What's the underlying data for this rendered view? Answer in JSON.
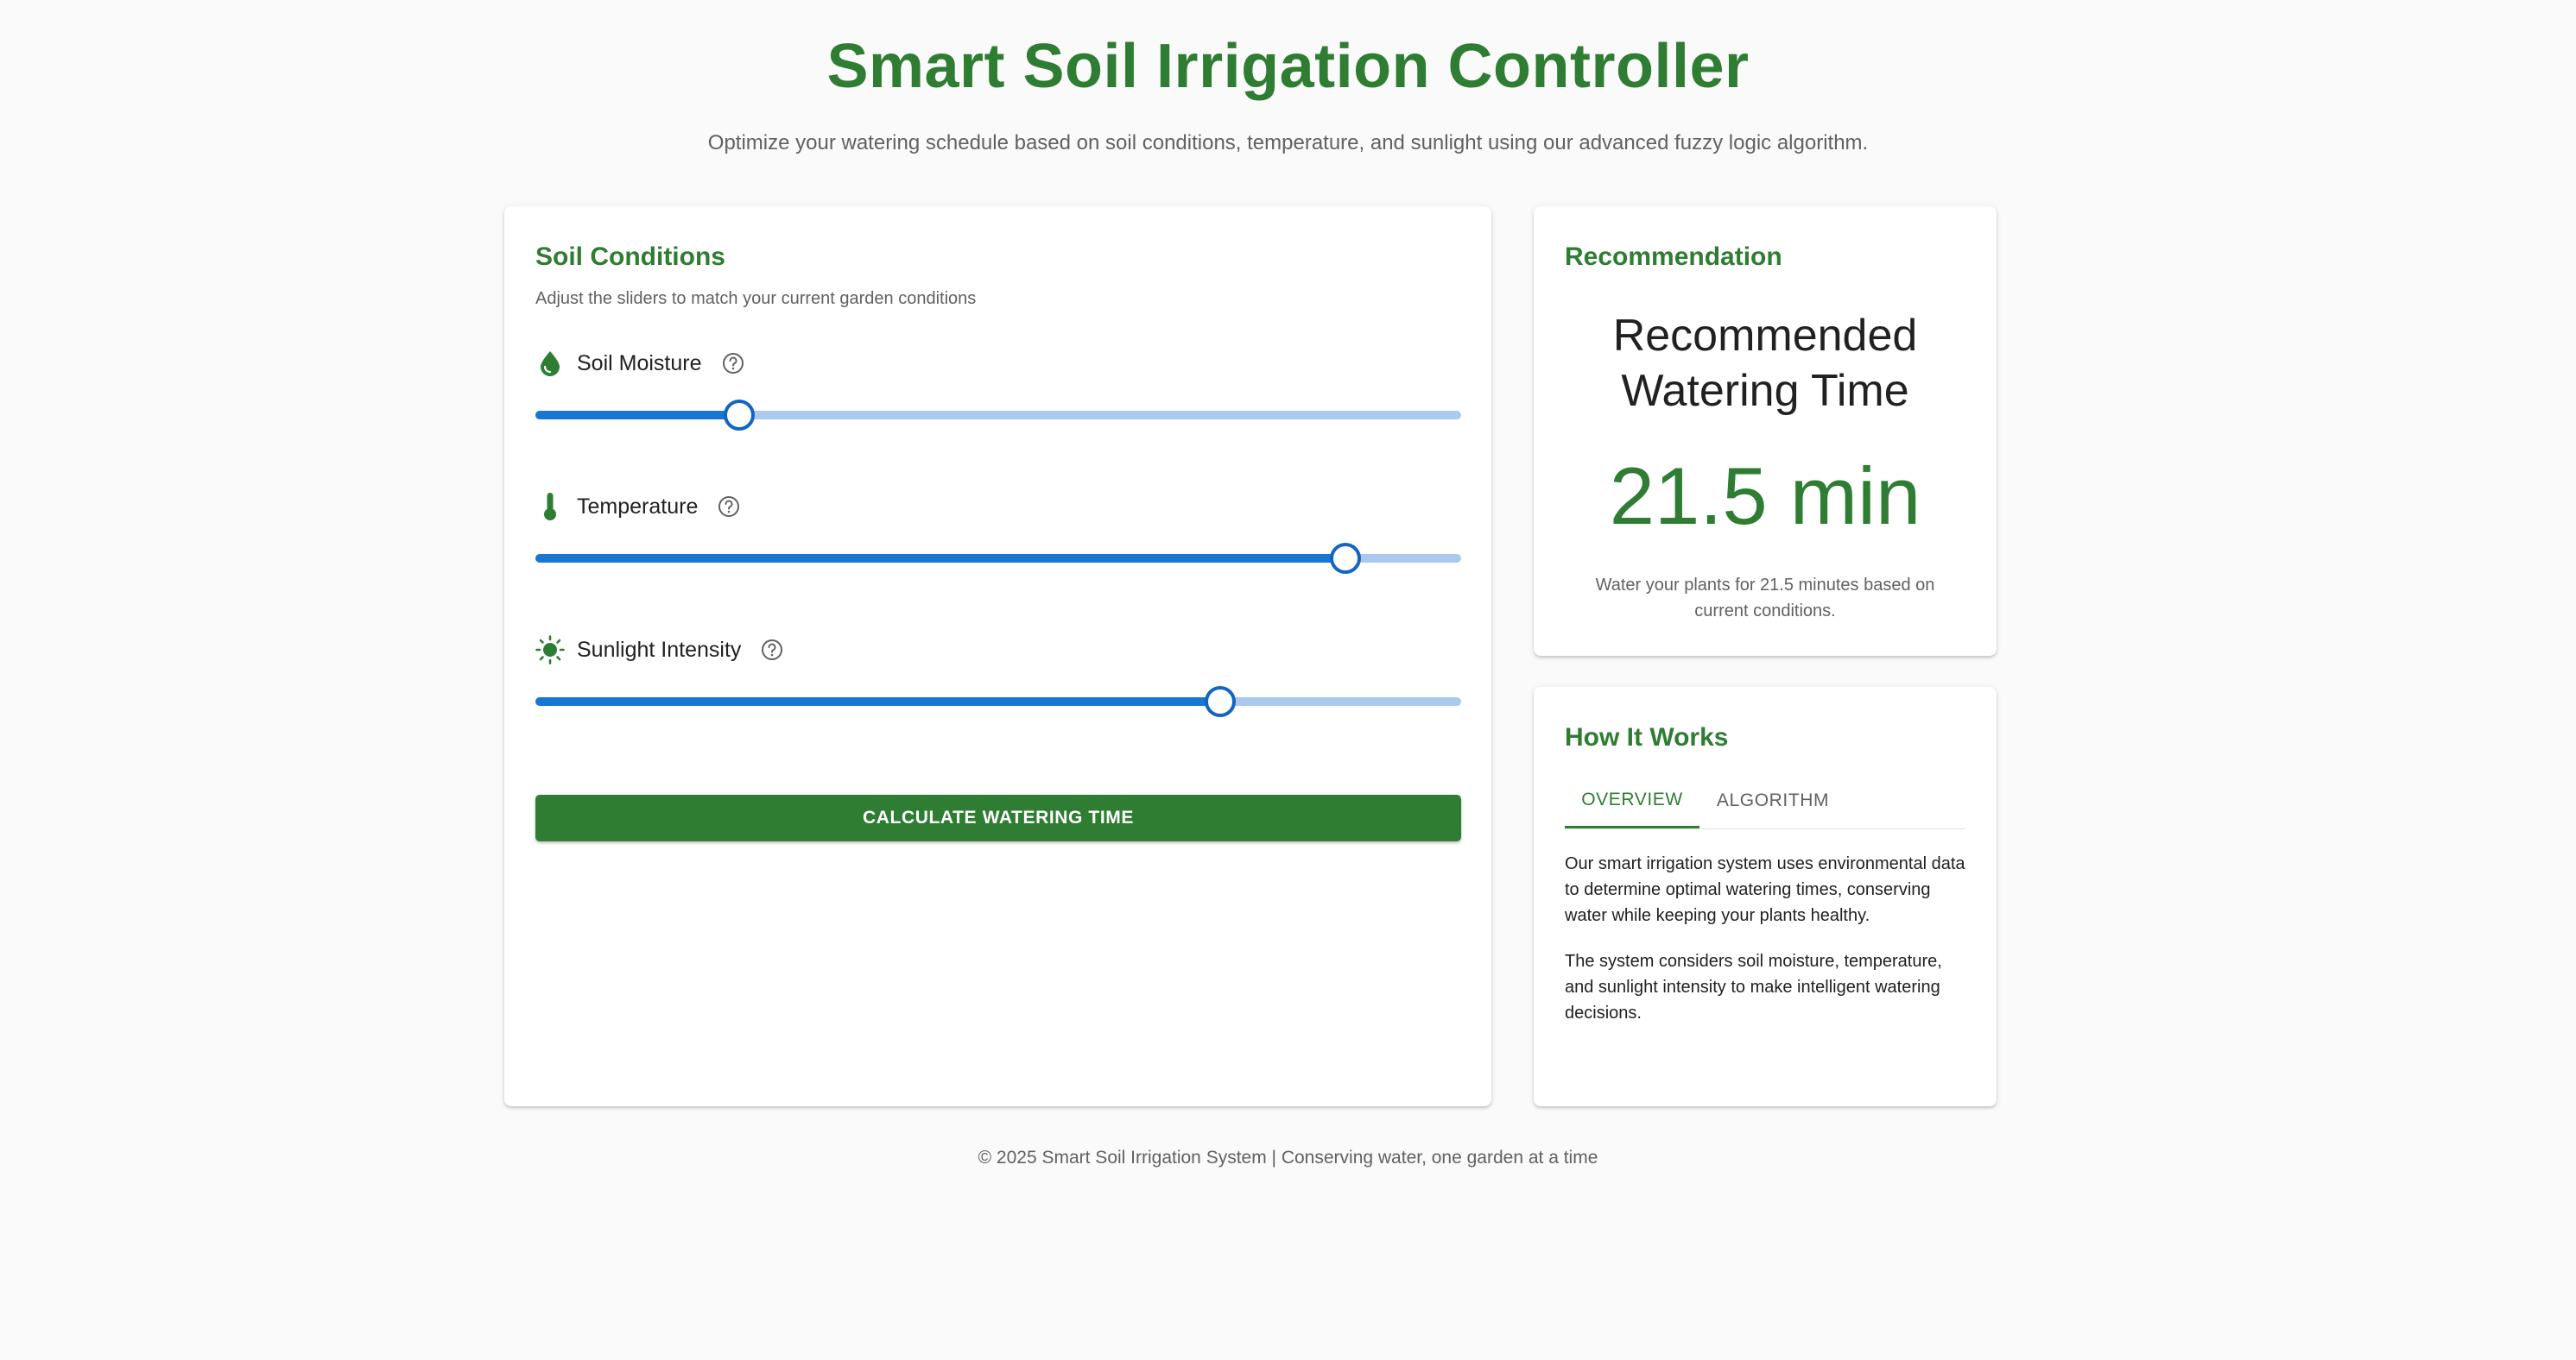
{
  "header": {
    "title": "Smart Soil Irrigation Controller",
    "subtitle": "Optimize your watering schedule based on soil conditions, temperature, and sunlight using our advanced fuzzy logic algorithm."
  },
  "soil_conditions": {
    "title": "Soil Conditions",
    "caption": "Adjust the sliders to match your current garden conditions",
    "sliders": [
      {
        "label": "Soil Moisture",
        "icon": "water-drop-icon",
        "value_percent": 22
      },
      {
        "label": "Temperature",
        "icon": "thermometer-icon",
        "value_percent": 87.5
      },
      {
        "label": "Sunlight Intensity",
        "icon": "sun-icon",
        "value_percent": 74
      }
    ],
    "button_label": "CALCULATE WATERING TIME"
  },
  "recommendation": {
    "title": "Recommendation",
    "heading": "Recommended Watering Time",
    "value": "21.5 min",
    "note": "Water your plants for 21.5 minutes based on current conditions."
  },
  "how_it_works": {
    "title": "How It Works",
    "tabs": [
      {
        "label": "OVERVIEW",
        "active": true
      },
      {
        "label": "ALGORITHM",
        "active": false
      }
    ],
    "paragraphs": [
      "Our smart irrigation system uses environmental data to determine optimal watering times, conserving water while keeping your plants healthy.",
      "The system considers soil moisture, temperature, and sunlight intensity to make intelligent watering decisions."
    ]
  },
  "footer": "© 2025 Smart Soil Irrigation System | Conserving water, one garden at a time",
  "colors": {
    "brand_green": "#2e7d32",
    "slider_blue": "#1976d2",
    "slider_track": "#a9c9ef",
    "background": "#fafafa"
  }
}
